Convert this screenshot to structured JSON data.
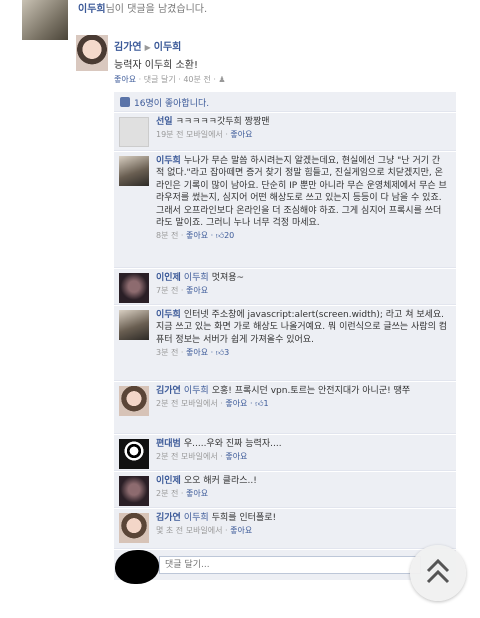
{
  "notification": {
    "name": "이두희",
    "text": "님이 댓글을 남겼습니다."
  },
  "post": {
    "author": "김가연",
    "arrow": "▶",
    "target": "이두희",
    "text": "능력자 이두희 소환!",
    "meta_like": "좋아요",
    "meta_rest": " · 댓글 달기 · 40분 전 · ",
    "likes_text": "16명이 좋아합니다."
  },
  "comments": [
    {
      "name": "선일",
      "tag": "",
      "text": "ㅋㅋㅋㅋㅋ갓두희 짱짱맨",
      "time": "19분 전 모바일에서 · ",
      "like": "좋아요",
      "likes": ""
    },
    {
      "name": "이두희",
      "tag": "",
      "text": "누나가 무슨 말씀 하시려는지 알겠는데요, 현실에선 그냥 \"난 거기 간적 없다.\"라고 잡아떼면 증거 찾기 정말 힘들고, 진실게임으로 치닫겠지만, 온라인은 기록이 많이 남아요. 단순히 IP 뿐만 아니라 무슨 운영체제에서 무슨 브라우저를 썼는지, 심지어 어떤 해상도로 쓰고 있는지 등등이 다 남을 수 있죠. 그래서 오프라인보다 온라인을 더 조심해야 하죠. 그게 심지어 프록시를 쓰더라도 말이죠. 그러니 누나 너무 걱정 마세요.",
      "time": "8분 전 · ",
      "like": "좋아요",
      "likes": "20"
    },
    {
      "name": "이인제",
      "tag": "이두희",
      "text": "멋져용~",
      "time": "7분 전 · ",
      "like": "좋아요",
      "likes": ""
    },
    {
      "name": "이두희",
      "tag": "",
      "text": "인터넷 주소창에 javascript:alert(screen.width); 라고 쳐 보세요. 지금 쓰고 있는 화면 가로 해상도 나올거예요. 뭐 이런식으로 글쓰는 사람의 컴퓨터 정보는 서버가 쉽게 가져올수 있어요.",
      "time": "3분 전 · ",
      "like": "좋아요",
      "likes": "3"
    },
    {
      "name": "김가연",
      "tag": "이두희",
      "text": "오홍! 프록시던 vpn.토르는 안전지대가 아니군! 땡쭈",
      "time": "2분 전 모바일에서 · ",
      "like": "좋아요",
      "likes": "1"
    },
    {
      "name": "편대범",
      "tag": "",
      "text": "우.....우와 진짜 능력자....",
      "time": "2분 전 모바일에서 · ",
      "like": "좋아요",
      "likes": ""
    },
    {
      "name": "이인제",
      "tag": "",
      "text": "오오 해커 클라스..!",
      "time": "2분 전 · ",
      "like": "좋아요",
      "likes": ""
    },
    {
      "name": "김가연",
      "tag": "이두희",
      "text": "두희를 인터폴로!",
      "time": "몇 초 전 모바일에서 · ",
      "like": "좋아요",
      "likes": ""
    }
  ],
  "reply": {
    "placeholder": "댓글 달기..."
  },
  "icons": {
    "thumb": "thumbs-up-icon",
    "scroll_top": "double-chevron-up-icon"
  }
}
